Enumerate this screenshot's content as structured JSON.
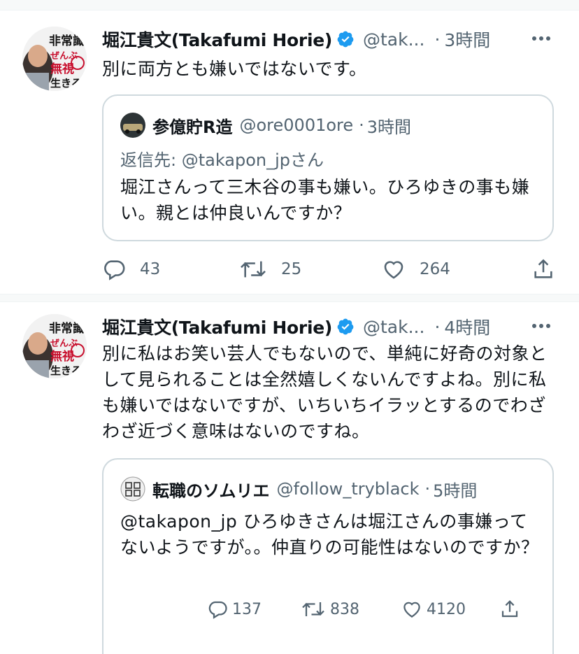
{
  "tweets": [
    {
      "author_name": "堀江貴文(Takafumi Horie)",
      "author_handle": "@tak...",
      "time": "3時間",
      "text": "別に両方とも嫌いではないです。",
      "quote": {
        "author_name": "参億貯R造",
        "author_handle": "@ore0001ore",
        "time": "3時間",
        "reply_to": "返信先: @takapon_jpさん",
        "text": "堀江さんって三木谷の事も嫌い。ひろゆきの事も嫌い。親とは仲良いんですか？"
      },
      "actions": {
        "replies": "43",
        "retweets": "25",
        "likes": "264"
      }
    },
    {
      "author_name": "堀江貴文(Takafumi Horie)",
      "author_handle": "@tak...",
      "time": "4時間",
      "text": "別に私はお笑い芸人でもないので、単純に好奇の対象として見られることは全然嬉しくないんですよね。別に私も嫌いではないですが、いちいちイラッとするのでわざわざ近づく意味はないのですね。",
      "quote": {
        "author_name": "転職のソムリエ",
        "author_handle": "@follow_tryblack",
        "time": "5時間",
        "text": "@takapon_jp ひろゆきさんは堀江さんの事嫌ってないようですが。。仲直りの可能性はないのですか？",
        "actions": {
          "replies": "137",
          "retweets": "838",
          "likes": "4120"
        }
      }
    }
  ],
  "avatar_text": {
    "line1": "非常識",
    "line2": "ぜんぶ",
    "line3": "無視",
    "line4": "生きる"
  },
  "colors": {
    "accent": "#1d9bf0",
    "muted": "#536471",
    "border": "#cfd9de"
  }
}
